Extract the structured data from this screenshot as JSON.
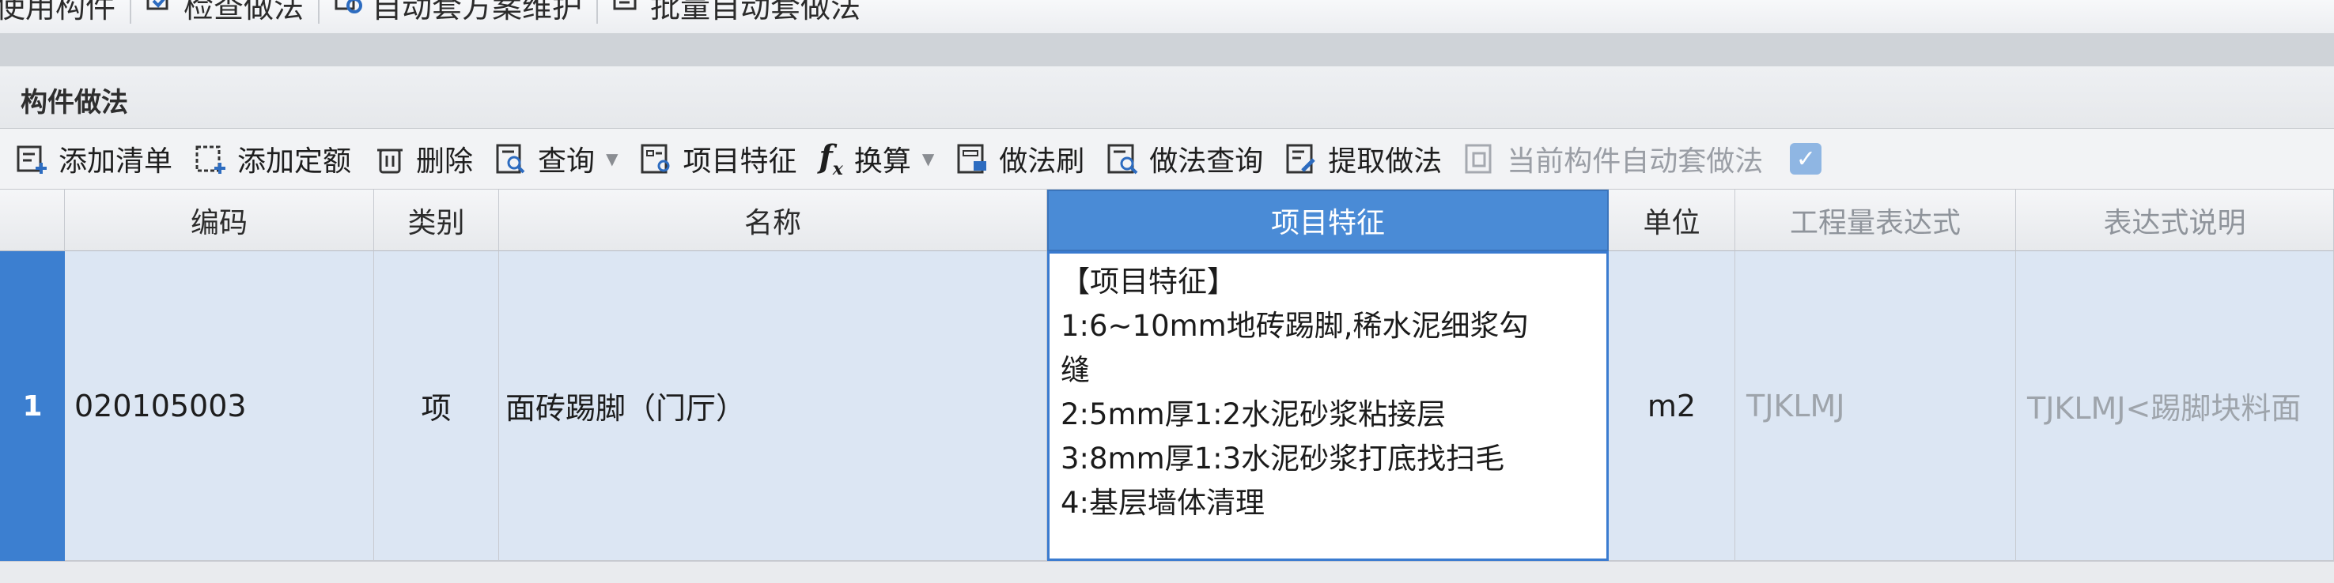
{
  "top_toolbar": {
    "items": [
      "使用构件",
      "检查做法",
      "自动套方案维护",
      "批量自动套做法"
    ]
  },
  "panel": {
    "title": "构件做法"
  },
  "toolbar": {
    "add_list": "添加清单",
    "add_quota": "添加定额",
    "delete": "删除",
    "query": "查询",
    "project_feature": "项目特征",
    "convert_fx": "f",
    "convert_fx_sub": "x",
    "convert": "换算",
    "method_brush": "做法刷",
    "method_query": "做法查询",
    "extract_method": "提取做法",
    "auto_apply": "当前构件自动套做法",
    "checkbox_mark": "✓"
  },
  "grid": {
    "headers": {
      "code": "编码",
      "category": "类别",
      "name": "名称",
      "feature": "项目特征",
      "unit": "单位",
      "expression": "工程量表达式",
      "expression_note": "表达式说明"
    },
    "rows": [
      {
        "row_number": "1",
        "code": "020105003",
        "category": "项",
        "name": "面砖踢脚（门厅）",
        "feature_lines": [
          "【项目特征】",
          "1:6~10mm地砖踢脚,稀水泥细浆勾",
          "缝",
          "2:5mm厚1:2水泥砂浆粘接层",
          "3:8mm厚1:3水泥砂浆打底找扫毛",
          "4:基层墙体清理"
        ],
        "unit": "m2",
        "expression": "TJKLMJ",
        "expression_note": "TJKLMJ<踢脚块料面"
      }
    ]
  },
  "colors": {
    "accent": "#3c7fd0",
    "selected_row_bg": "#dce6f3",
    "header_active": "#4a8bd6"
  }
}
